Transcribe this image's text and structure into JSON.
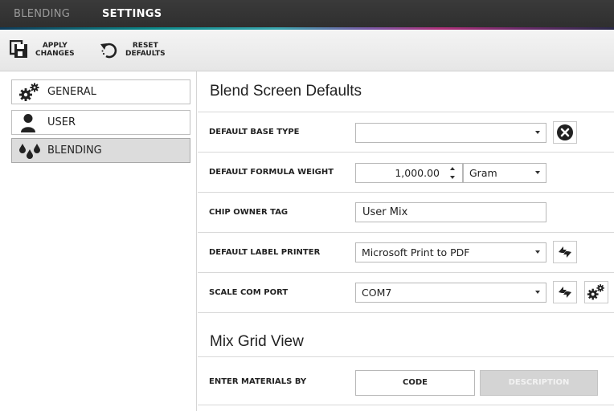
{
  "nav": {
    "tab_blending": "BLENDING",
    "tab_settings": "SETTINGS"
  },
  "toolbar": {
    "apply_line1": "APPLY",
    "apply_line2": "CHANGES",
    "reset_line1": "RESET",
    "reset_line2": "DEFAULTS"
  },
  "sidebar": {
    "items": [
      {
        "label": "GENERAL",
        "icon": "gears-icon"
      },
      {
        "label": "USER",
        "icon": "user-icon"
      },
      {
        "label": "BLENDING",
        "icon": "drops-icon",
        "active": true
      }
    ]
  },
  "blend": {
    "title": "Blend Screen Defaults",
    "base_type_label": "DEFAULT BASE TYPE",
    "base_type_value": "",
    "formula_weight_label": "DEFAULT FORMULA WEIGHT",
    "formula_weight_value": "1,000.00",
    "formula_unit": "Gram",
    "chip_owner_label": "CHIP OWNER TAG",
    "chip_owner_value": "User Mix",
    "label_printer_label": "DEFAULT LABEL PRINTER",
    "label_printer_value": "Microsoft Print to PDF",
    "scale_port_label": "SCALE COM PORT",
    "scale_port_value": "COM7"
  },
  "mixgrid": {
    "title": "Mix Grid View",
    "enter_by_label": "ENTER MATERIALS BY",
    "option_code": "CODE",
    "option_description": "DESCRIPTION",
    "selected": "CODE"
  },
  "colors": {
    "topbar": "#333333",
    "active_item": "#dcdcdc",
    "disabled_button": "#d4d4d4"
  }
}
